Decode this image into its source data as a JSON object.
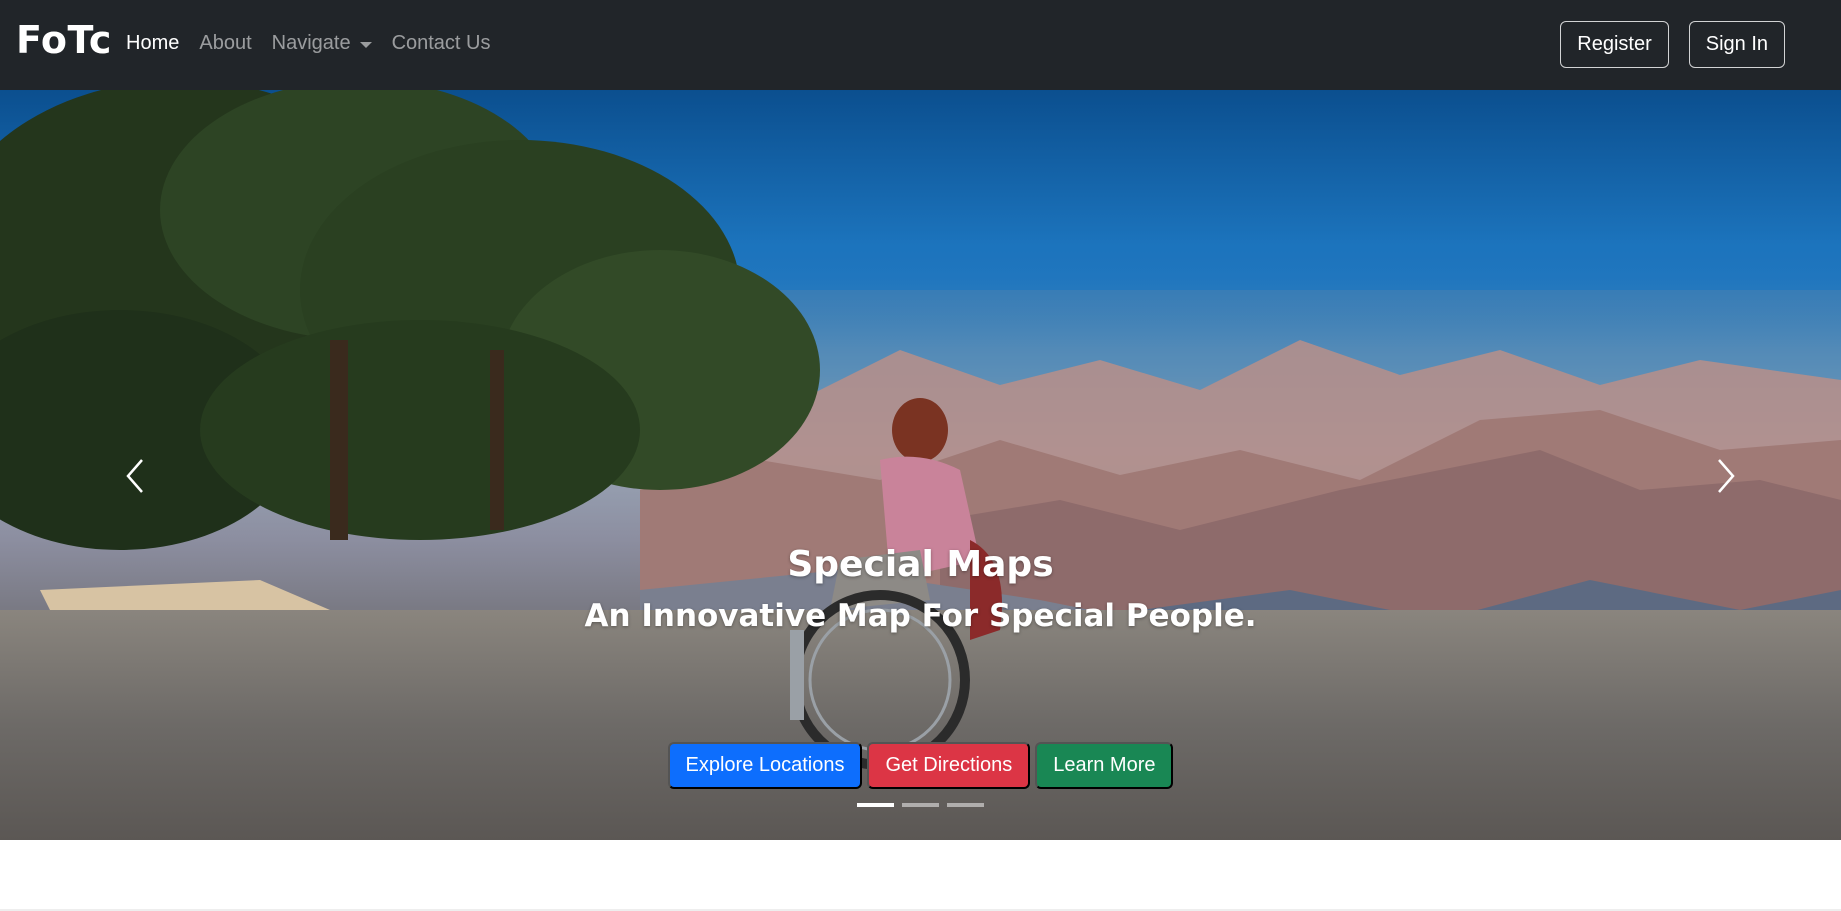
{
  "navbar": {
    "brand": "FoTc",
    "links": [
      {
        "label": "Home",
        "active": true
      },
      {
        "label": "About",
        "active": false
      },
      {
        "label": "Navigate",
        "active": false,
        "dropdown": true
      },
      {
        "label": "Contact Us",
        "active": false
      }
    ],
    "register_label": "Register",
    "signin_label": "Sign In"
  },
  "carousel": {
    "title": "Special Maps",
    "subtitle": "An Innovative Map For Special People.",
    "buttons": [
      {
        "label": "Explore Locations",
        "color": "#0d6efd"
      },
      {
        "label": "Get Directions",
        "color": "#dc3545"
      },
      {
        "label": "Learn More",
        "color": "#198754"
      }
    ],
    "indicator_count": 3,
    "active_indicator": 1,
    "prev_icon": "chevron-left-icon",
    "next_icon": "chevron-right-icon"
  },
  "colors": {
    "navbar_bg": "#212529",
    "primary": "#0d6efd",
    "danger": "#dc3545",
    "success": "#198754"
  }
}
